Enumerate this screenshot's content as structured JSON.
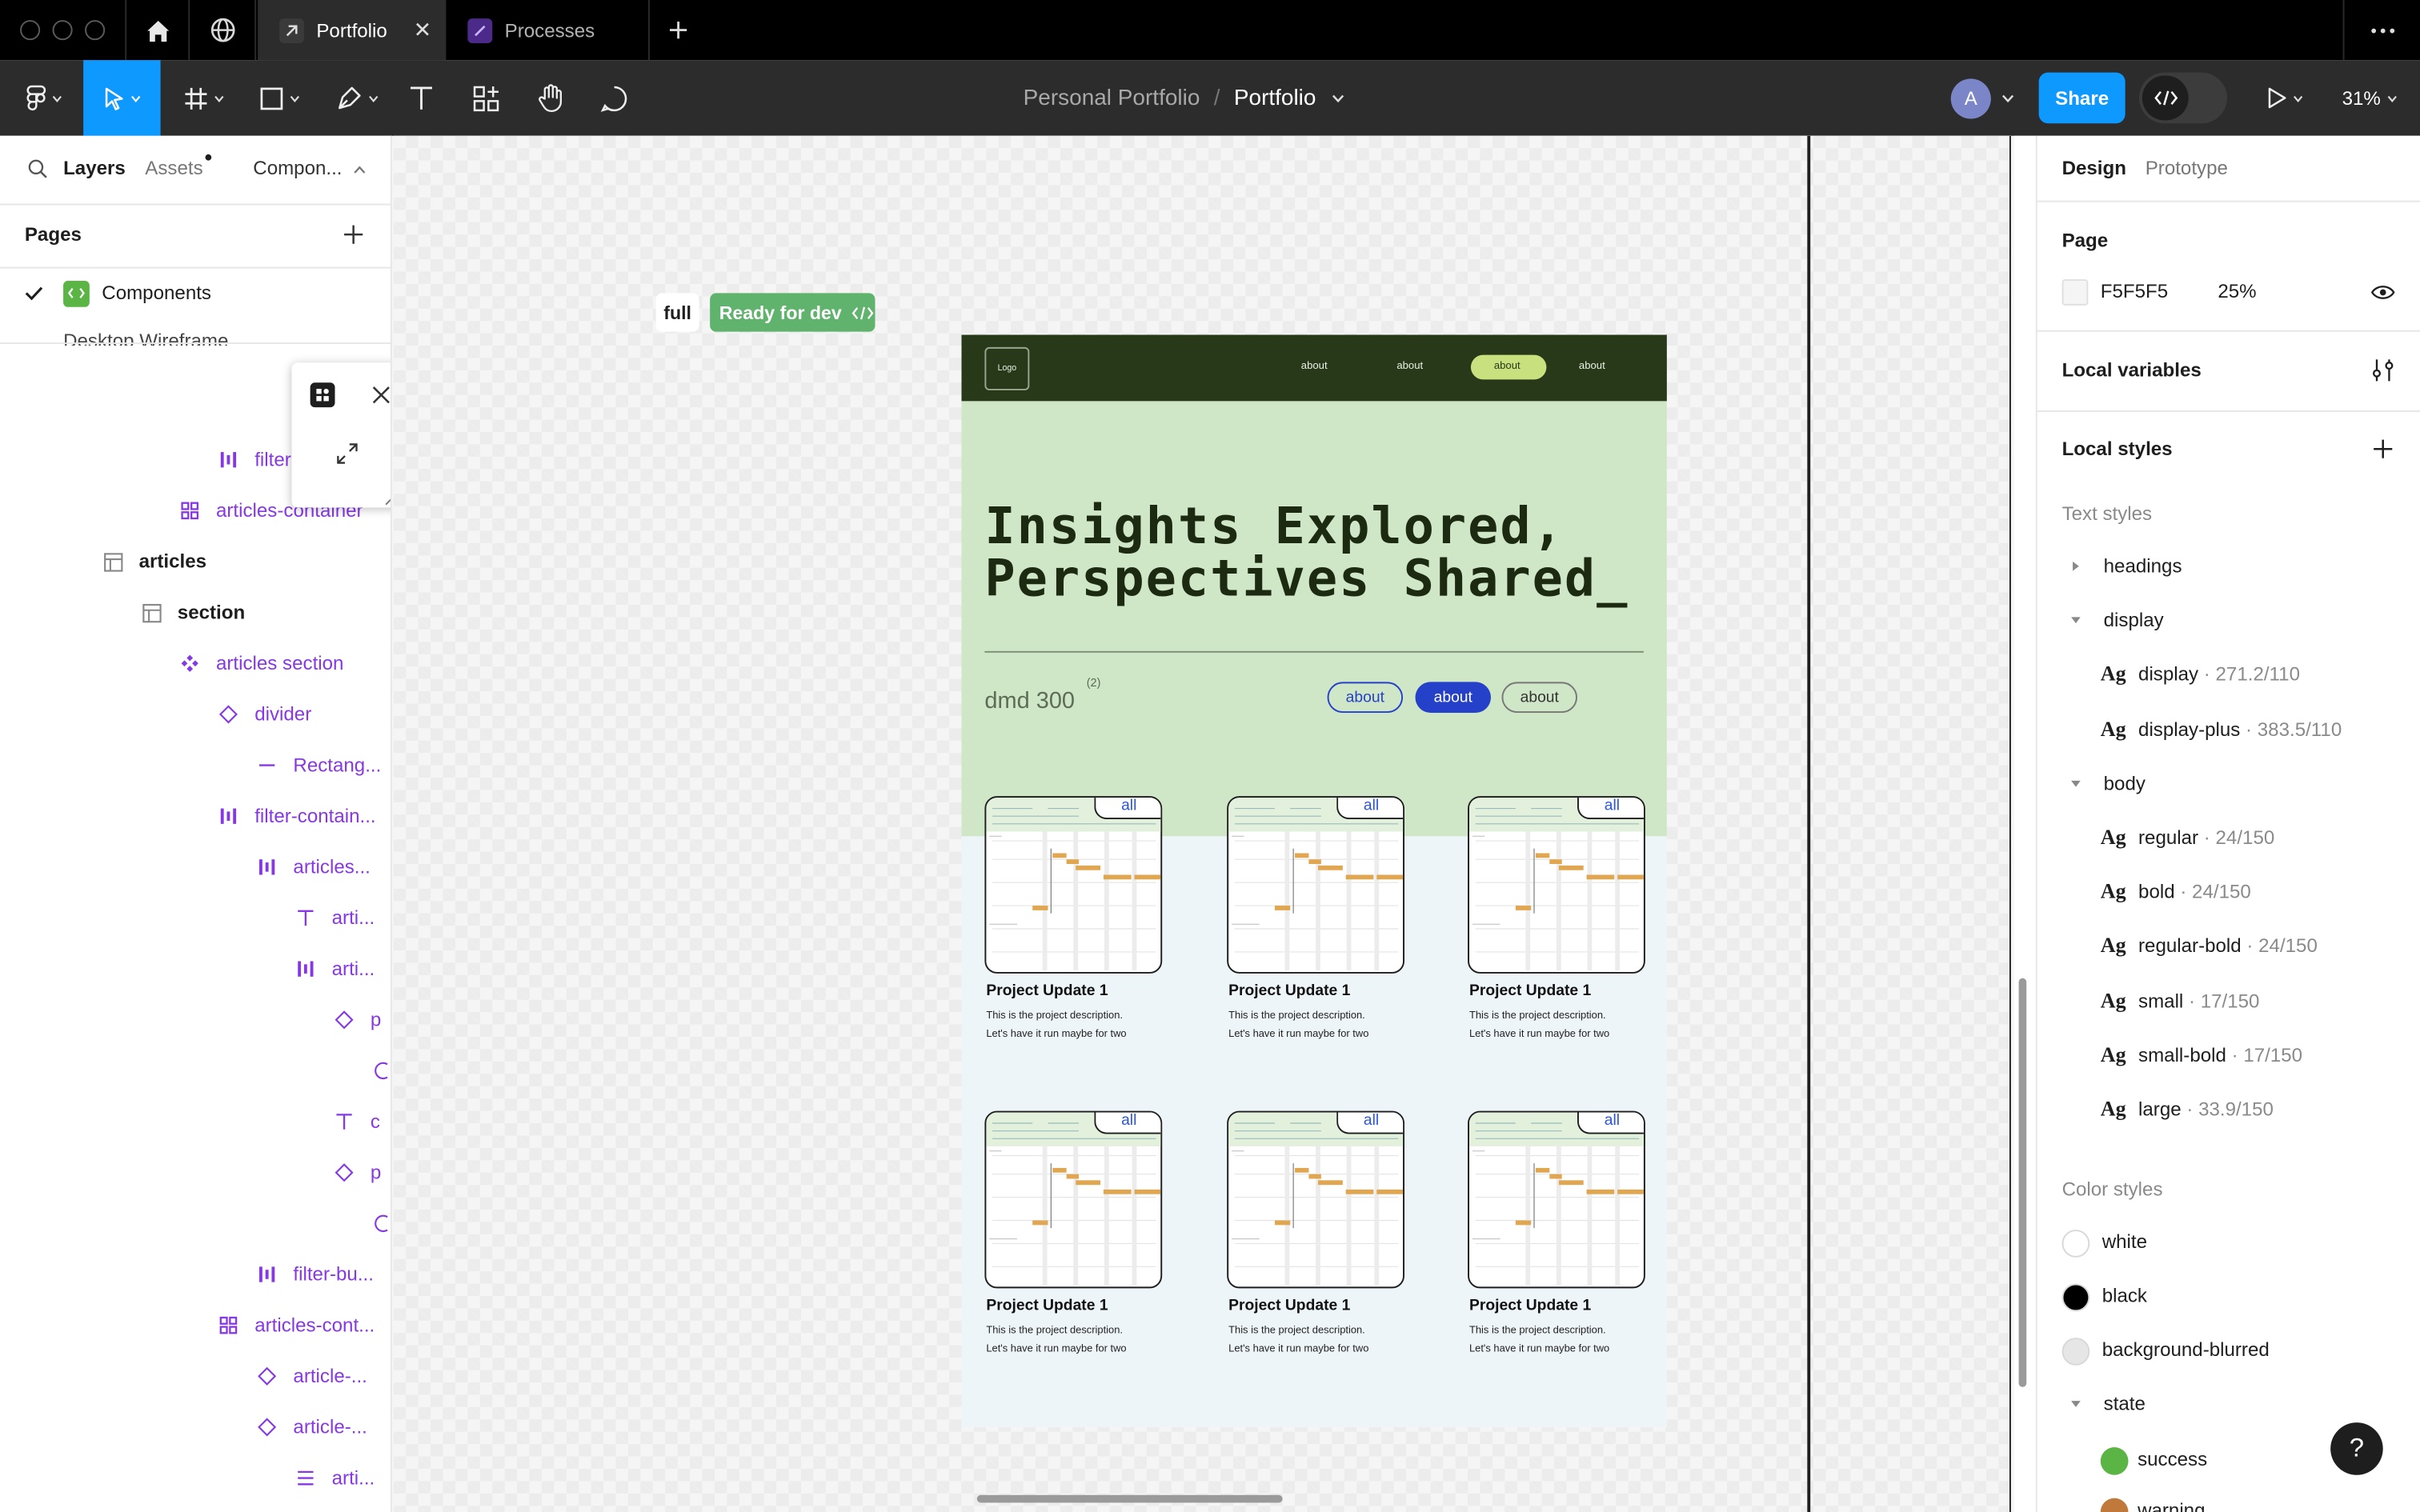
{
  "titlebar": {
    "tabs": [
      {
        "label": "Portfolio",
        "active": true
      },
      {
        "label": "Processes",
        "active": false
      }
    ],
    "icons": [
      "home-icon",
      "globe-icon",
      "plus-icon",
      "more-icon"
    ]
  },
  "toolbar": {
    "breadcrumb": {
      "project": "Personal Portfolio",
      "separator": "/",
      "file": "Portfolio"
    },
    "avatar_initial": "A",
    "share_label": "Share",
    "zoom": "31%"
  },
  "left_panel": {
    "tabs": {
      "layers": "Layers",
      "assets": "Assets",
      "components": "Compon..."
    },
    "pages_header": "Pages",
    "pages": [
      {
        "label": "Components",
        "selected": true
      },
      {
        "label": "Desktop Wireframe",
        "selected": false
      }
    ],
    "layers": [
      {
        "label": "filter",
        "icon": "vertical-bars-icon",
        "purple": true
      },
      {
        "label": "articles-container",
        "icon": "grid-dots-icon",
        "purple": true
      },
      {
        "label": "articles",
        "icon": "frame-icon",
        "purple": false
      },
      {
        "label": "section",
        "icon": "frame-icon",
        "purple": false
      },
      {
        "label": "articles section",
        "icon": "component-icon",
        "purple": true
      },
      {
        "label": "divider",
        "icon": "diamond-icon",
        "purple": true
      },
      {
        "label": "Rectang...",
        "icon": "line-icon",
        "purple": true
      },
      {
        "label": "filter-contain...",
        "icon": "vertical-bars-icon",
        "purple": true
      },
      {
        "label": "articles...",
        "icon": "vertical-bars-icon",
        "purple": true
      },
      {
        "label": "arti...",
        "icon": "text-icon",
        "purple": true
      },
      {
        "label": "arti...",
        "icon": "vertical-bars-icon",
        "purple": true
      },
      {
        "label": "p",
        "icon": "diamond-icon",
        "purple": true
      },
      {
        "label": "",
        "icon": "partial-circle-icon",
        "purple": true
      },
      {
        "label": "c",
        "icon": "text-icon",
        "purple": true
      },
      {
        "label": "p",
        "icon": "diamond-icon",
        "purple": true
      },
      {
        "label": "",
        "icon": "partial-circle-icon",
        "purple": true
      },
      {
        "label": "filter-bu...",
        "icon": "vertical-bars-icon",
        "purple": true
      },
      {
        "label": "articles-cont...",
        "icon": "grid-dots-icon",
        "purple": true
      },
      {
        "label": "article-...",
        "icon": "diamond-icon",
        "purple": true
      },
      {
        "label": "article-...",
        "icon": "diamond-icon",
        "purple": true
      },
      {
        "label": "arti...",
        "icon": "text-lines-icon",
        "purple": true
      }
    ]
  },
  "canvas": {
    "frame_label": "full",
    "status_badge": "Ready for dev",
    "mockup": {
      "logo": "Logo",
      "nav_links": [
        "about",
        "about",
        "about",
        "about"
      ],
      "active_nav_index": 2,
      "headline_line1": "Insights Explored,",
      "headline_line2": "Perspectives Shared_",
      "subtext": "dmd 300",
      "superscript": "(2)",
      "filter_pills": [
        "about",
        "about",
        "about"
      ],
      "active_filter_index": 1,
      "cards": [
        {
          "tab": "all",
          "title": "Project Update 1",
          "desc1": "This is the project description.",
          "desc2": "Let's have it run maybe for two"
        },
        {
          "tab": "all",
          "title": "Project Update 1",
          "desc1": "This is the project description.",
          "desc2": "Let's have it run maybe for two"
        },
        {
          "tab": "all",
          "title": "Project Update 1",
          "desc1": "This is the project description.",
          "desc2": "Let's have it run maybe for two"
        },
        {
          "tab": "all",
          "title": "Project Update 1",
          "desc1": "This is the project description.",
          "desc2": "Let's have it run maybe for two"
        },
        {
          "tab": "all",
          "title": "Project Update 1",
          "desc1": "This is the project description.",
          "desc2": "Let's have it run maybe for two"
        },
        {
          "tab": "all",
          "title": "Project Update 1",
          "desc1": "This is the project description.",
          "desc2": "Let's have it run maybe for two"
        }
      ]
    }
  },
  "right_panel": {
    "tabs": {
      "design": "Design",
      "prototype": "Prototype"
    },
    "page_section": {
      "title": "Page",
      "color_hex": "F5F5F5",
      "opacity": "25%"
    },
    "local_variables": "Local variables",
    "local_styles": "Local styles",
    "text_styles_header": "Text styles",
    "text_groups": [
      {
        "label": "headings",
        "expanded": false,
        "items": []
      },
      {
        "label": "display",
        "expanded": true,
        "items": [
          {
            "name": "display",
            "spec": "271.2/110"
          },
          {
            "name": "display-plus",
            "spec": "383.5/110"
          }
        ]
      },
      {
        "label": "body",
        "expanded": true,
        "items": [
          {
            "name": "regular",
            "spec": "24/150"
          },
          {
            "name": "bold",
            "spec": "24/150"
          },
          {
            "name": "regular-bold",
            "spec": "24/150"
          },
          {
            "name": "small",
            "spec": "17/150"
          },
          {
            "name": "small-bold",
            "spec": "17/150"
          },
          {
            "name": "large",
            "spec": "33.9/150"
          }
        ]
      }
    ],
    "color_styles_header": "Color styles",
    "colors": [
      {
        "name": "white",
        "hex": "#ffffff"
      },
      {
        "name": "black",
        "hex": "#000000"
      },
      {
        "name": "background-blurred",
        "hex": "#e6e6e6"
      }
    ],
    "state_group": "state",
    "state_colors": [
      {
        "name": "success",
        "hex": "#5bb544"
      },
      {
        "name": "warning",
        "hex": "#c0793a"
      }
    ],
    "help_label": "?"
  },
  "colors": {
    "accent_blue": "#0d99ff",
    "ready_green": "#5fb36c",
    "nav_dark_green": "#28391a",
    "hero_green": "#cfe7c6",
    "active_pill_blue": "#2641c9",
    "layer_purple": "#8638e5"
  }
}
